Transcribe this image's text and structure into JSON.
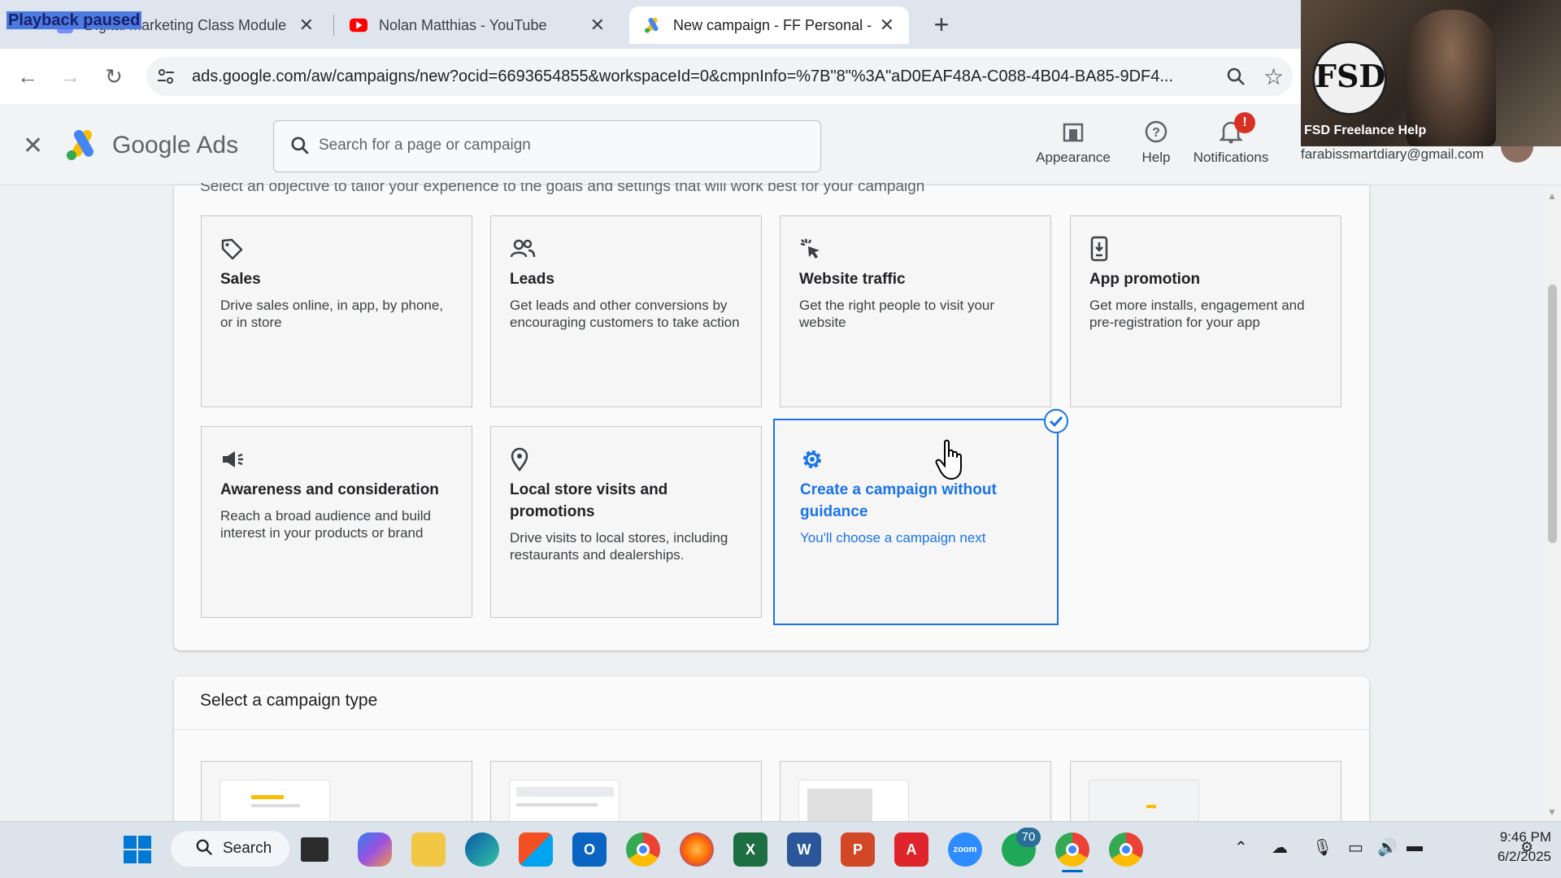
{
  "browser": {
    "playback_overlay": "Playback paused",
    "tabs": [
      {
        "title": "Digital Marketing Class Module",
        "active": false
      },
      {
        "title": "Nolan Matthias - YouTube",
        "active": false
      },
      {
        "title": "New campaign - FF Personal - G",
        "active": true
      }
    ],
    "url": "ads.google.com/aw/campaigns/new?ocid=6693654855&workspaceId=0&cmpnInfo=%7B\"8\"%3A\"aD0EAF48A-C088-4B04-BA85-9DF4..."
  },
  "ads_header": {
    "product_name": "Google Ads",
    "search_placeholder": "Search for a page or campaign",
    "appearance_label": "Appearance",
    "help_label": "Help",
    "notifications_label": "Notifications",
    "notifications_badge": "!",
    "account_email": "farabissmartdiary@gmail.com"
  },
  "webcam": {
    "logo_text": "FSD",
    "caption": "FSD Freelance Help"
  },
  "objective_section": {
    "hint": "Select an objective to tailor your experience to the goals and settings that will work best for your campaign",
    "objectives": [
      {
        "icon": "tag-icon",
        "title": "Sales",
        "description": "Drive sales online, in app, by phone, or in store",
        "selected": false
      },
      {
        "icon": "people-icon",
        "title": "Leads",
        "description": "Get leads and other conversions by encouraging customers to take action",
        "selected": false
      },
      {
        "icon": "cursor-click-icon",
        "title": "Website traffic",
        "description": "Get the right people to visit your website",
        "selected": false
      },
      {
        "icon": "phone-download-icon",
        "title": "App promotion",
        "description": "Get more installs, engagement and pre-registration for your app",
        "selected": false
      },
      {
        "icon": "megaphone-icon",
        "title": "Awareness and consideration",
        "description": "Reach a broad audience and build interest in your products or brand",
        "selected": false
      },
      {
        "icon": "location-pin-icon",
        "title": "Local store visits and promotions",
        "description": "Drive visits to local stores, including restaurants and dealerships.",
        "selected": false
      },
      {
        "icon": "gear-icon",
        "title": "Create a campaign without guidance",
        "description": "You'll choose a campaign next",
        "selected": true
      }
    ]
  },
  "campaign_type_section": {
    "title": "Select a campaign type"
  },
  "taskbar": {
    "search_label": "Search",
    "whatsapp_badge": "70",
    "time": "9:46 PM",
    "date": "6/2/2025"
  },
  "colors": {
    "accent": "#1a73e8",
    "notification": "#d93025"
  }
}
